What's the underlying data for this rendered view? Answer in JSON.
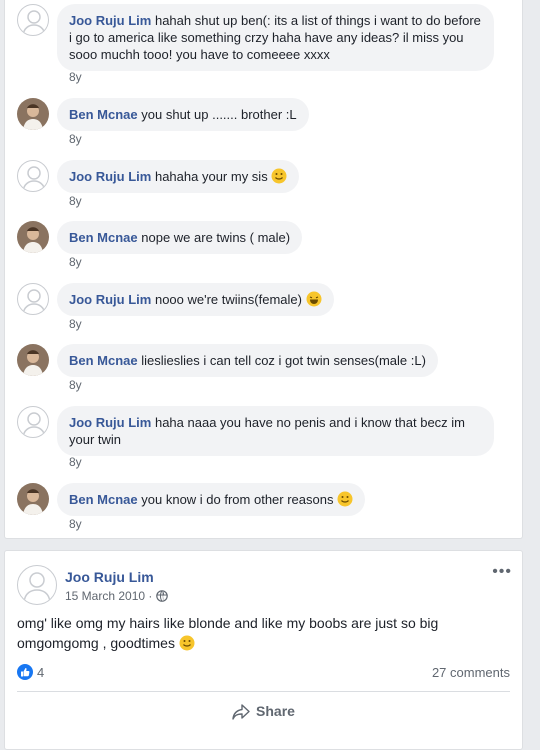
{
  "comments": [
    {
      "author": "Joo Ruju Lim",
      "text": "hahah shut up ben(: its a list of things i want to do before i go to america like something crzy haha have any ideas? il miss you sooo muchh tooo! you have to comeeee xxxx",
      "age": "8y",
      "avatar": "default"
    },
    {
      "author": "Ben Mcnae",
      "text": "you shut up ....... brother :L",
      "age": "8y",
      "avatar": "photo"
    },
    {
      "author": "Joo Ruju Lim",
      "text": "hahaha your my sis",
      "age": "8y",
      "avatar": "default",
      "emoji": "smile-emoji"
    },
    {
      "author": "Ben Mcnae",
      "text": "nope we are twins ( male)",
      "age": "8y",
      "avatar": "photo"
    },
    {
      "author": "Joo Ruju Lim",
      "text": "nooo we're twiins(female)",
      "age": "8y",
      "avatar": "default",
      "emoji": "laugh-emoji"
    },
    {
      "author": "Ben Mcnae",
      "text": "lieslieslies i can tell coz i got twin senses(male :L)",
      "age": "8y",
      "avatar": "photo"
    },
    {
      "author": "Joo Ruju Lim",
      "text": "haha naaa you have no penis and i know that becz im your twin",
      "age": "8y",
      "avatar": "default"
    },
    {
      "author": "Ben Mcnae",
      "text": "you know i do from other reasons",
      "age": "8y",
      "avatar": "photo",
      "emoji": "smile-emoji"
    }
  ],
  "post": {
    "author": "Joo Ruju Lim",
    "date": "15 March 2010 ·",
    "more": "•••",
    "text": "omg' like omg my hairs like blonde and like my boobs are just so big omgomgomg , goodtimes",
    "text_emoji": "smile-emoji",
    "like_count": "4",
    "comments_label": "27 comments",
    "share_label": "Share",
    "icons": {
      "privacy": "globe-icon",
      "like": "like-icon",
      "share": "share-icon"
    }
  },
  "colors": {
    "link": "#385898",
    "bubble": "#f2f3f5",
    "like": "#1877f2",
    "meta": "#606770",
    "background": "#e9ebee"
  }
}
